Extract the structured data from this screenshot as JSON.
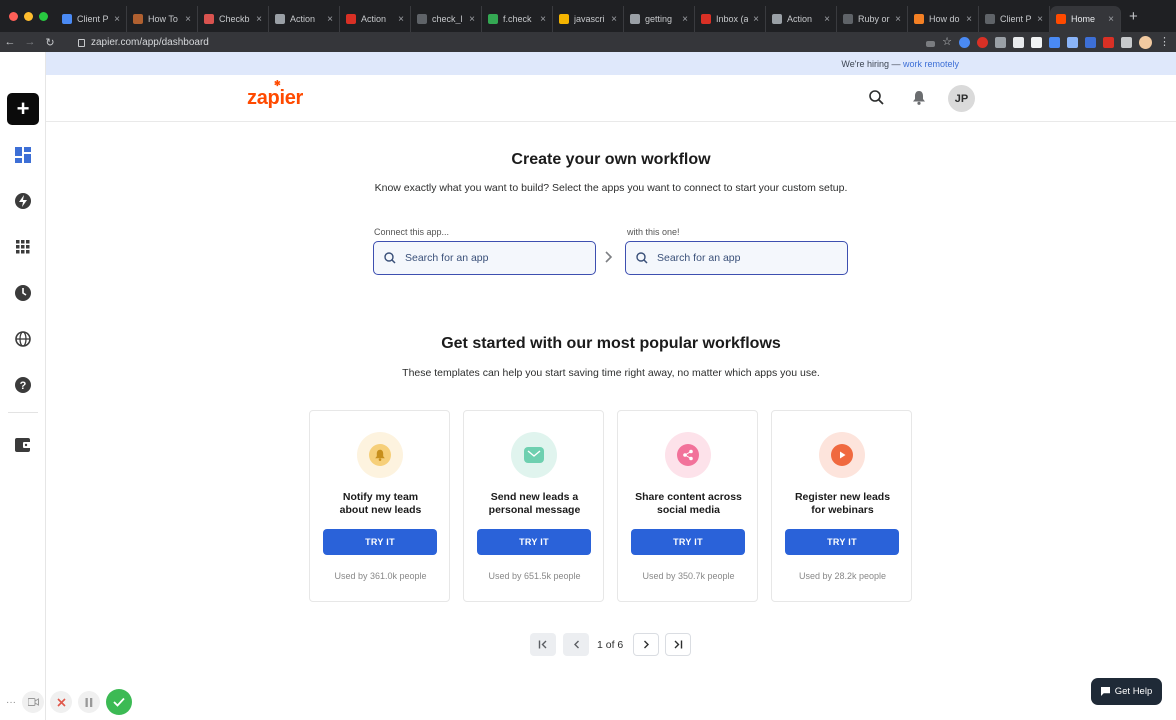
{
  "browser": {
    "tabs": [
      {
        "label": "Client P",
        "color": "#4a8af4",
        "active": false
      },
      {
        "label": "How To",
        "color": "#b06030",
        "active": false
      },
      {
        "label": "Checkb",
        "color": "#d9534f",
        "active": false
      },
      {
        "label": "Action",
        "color": "#9aa0a6",
        "active": false
      },
      {
        "label": "Action",
        "color": "#d93025",
        "active": false
      },
      {
        "label": "check_l",
        "color": "#5f6368",
        "active": false
      },
      {
        "label": "f.check",
        "color": "#34a853",
        "active": false
      },
      {
        "label": "javascri",
        "color": "#f4b400",
        "active": false
      },
      {
        "label": "getting",
        "color": "#9aa0a6",
        "active": false
      },
      {
        "label": "Inbox (a",
        "color": "#d93025",
        "active": false
      },
      {
        "label": "Action",
        "color": "#9aa0a6",
        "active": false
      },
      {
        "label": "Ruby or",
        "color": "#5f6368",
        "active": false
      },
      {
        "label": "How do",
        "color": "#f48024",
        "active": false
      },
      {
        "label": "Client P",
        "color": "#5f6368",
        "active": false
      },
      {
        "label": "Home",
        "color": "#ff4a00",
        "active": true
      }
    ],
    "url": "zapier.com/app/dashboard"
  },
  "banner": {
    "text": "We're hiring — ",
    "link": "work remotely"
  },
  "header": {
    "logo": "zapier",
    "avatar_initials": "JP"
  },
  "create": {
    "title": "Create your own workflow",
    "subtitle": "Know exactly what you want to build? Select the apps you want to connect to start your custom setup.",
    "left_label": "Connect this app...",
    "right_label": "with this one!",
    "left_placeholder": "Search for an app",
    "right_placeholder": "Search for an app"
  },
  "popular": {
    "title": "Get started with our most popular workflows",
    "subtitle": "These templates can help you start saving time right away, no matter which apps you use.",
    "cards": [
      {
        "line1": "Notify my team",
        "line2": "about new leads",
        "button": "TRY IT",
        "used": "Used by 361.0k people",
        "icon": "bell-icon"
      },
      {
        "line1": "Send new leads a",
        "line2": "personal message",
        "button": "TRY IT",
        "used": "Used by 651.5k people",
        "icon": "mail-icon"
      },
      {
        "line1": "Share content across",
        "line2": "social media",
        "button": "TRY IT",
        "used": "Used by 350.7k people",
        "icon": "share-icon"
      },
      {
        "line1": "Register new leads",
        "line2": "for webinars",
        "button": "TRY IT",
        "used": "Used by 28.2k people",
        "icon": "play-icon"
      }
    ]
  },
  "pagination": {
    "text": "1 of 6"
  },
  "help": {
    "label": "Get Help"
  },
  "colors": {
    "brand": "#ff4a00",
    "button": "#2a62d9",
    "input_border": "#3d4fb0"
  }
}
